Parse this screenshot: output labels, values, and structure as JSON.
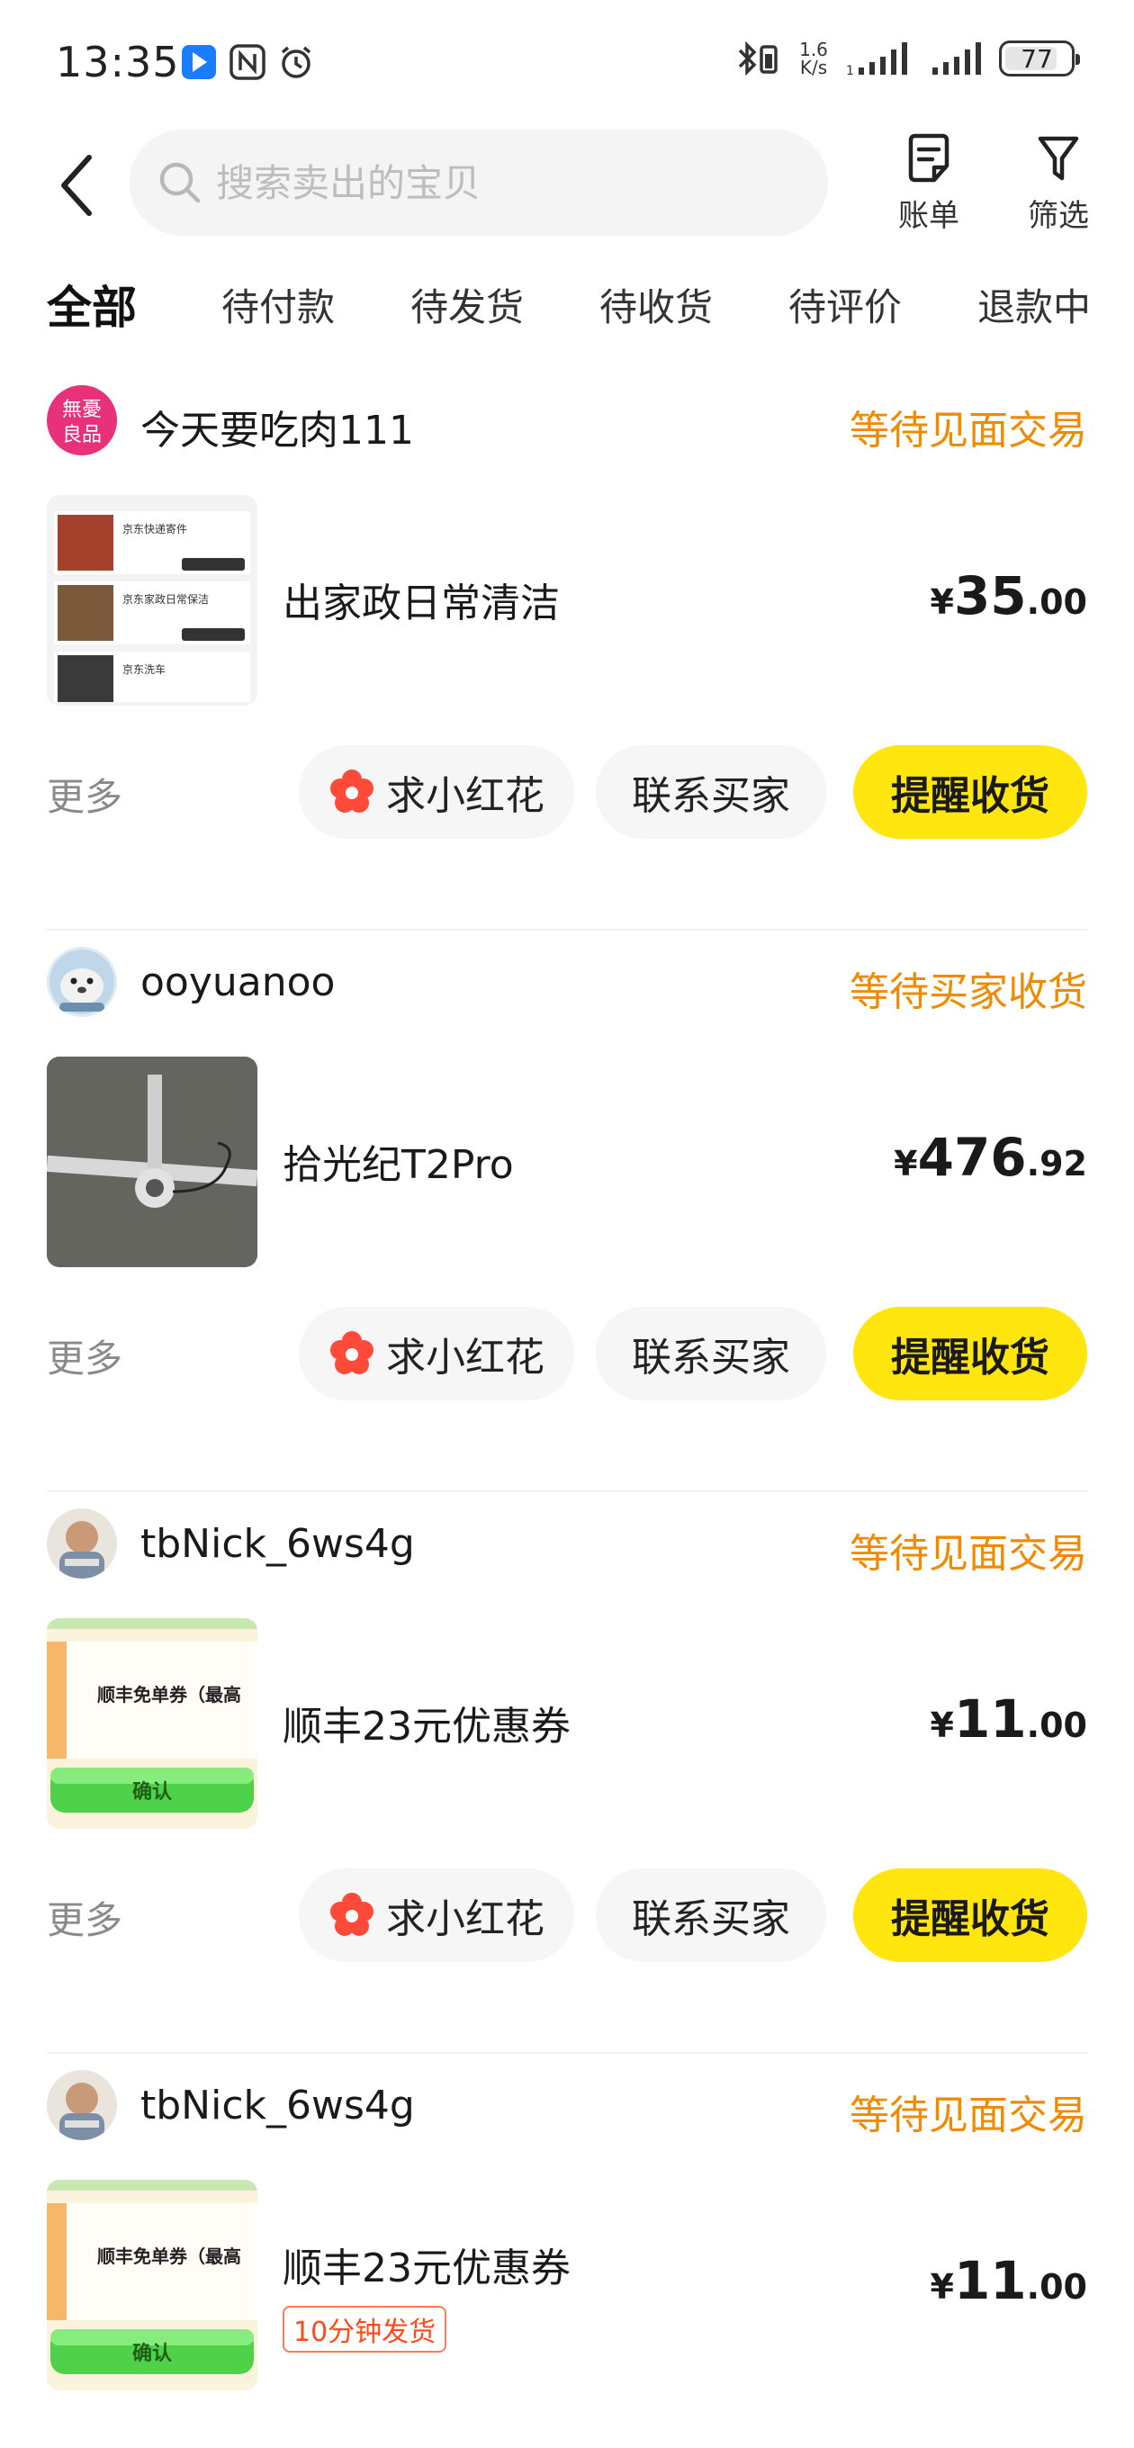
{
  "status_bar": {
    "time": "13:35",
    "net_speed_value": "1.6",
    "net_speed_unit": "K/s",
    "battery": "77"
  },
  "header": {
    "search_placeholder": "搜索卖出的宝贝",
    "bill_label": "账单",
    "filter_label": "筛选"
  },
  "tabs": [
    {
      "label": "全部",
      "active": true
    },
    {
      "label": "待付款",
      "active": false
    },
    {
      "label": "待发货",
      "active": false
    },
    {
      "label": "待收货",
      "active": false
    },
    {
      "label": "待评价",
      "active": false
    },
    {
      "label": "退款中",
      "active": false
    }
  ],
  "orders": [
    {
      "buyer": "今天要吃肉111",
      "status": "等待见面交易",
      "title": "出家政日常清洁",
      "price_currency": "¥",
      "price_int": "35",
      "price_dec": ".00",
      "more": "更多",
      "flower_btn": "求小红花",
      "contact_btn": "联系买家",
      "remind_btn": "提醒收货",
      "avatar_text": "無憂良品",
      "thumb_lines": [
        "京东快递寄件",
        "京东家政日常保洁",
        "京东洗车"
      ]
    },
    {
      "buyer": "ooyuanoo",
      "status": "等待买家收货",
      "title": "拾光纪T2Pro",
      "price_currency": "¥",
      "price_int": "476",
      "price_dec": ".92",
      "more": "更多",
      "flower_btn": "求小红花",
      "contact_btn": "联系买家",
      "remind_btn": "提醒收货"
    },
    {
      "buyer": "tbNick_6ws4g",
      "status": "等待见面交易",
      "title": "顺丰23元优惠券",
      "price_currency": "¥",
      "price_int": "11",
      "price_dec": ".00",
      "more": "更多",
      "flower_btn": "求小红花",
      "contact_btn": "联系买家",
      "remind_btn": "提醒收货",
      "thumb_text": "顺丰免单券（最高",
      "thumb_btn": "确认"
    },
    {
      "buyer": "tbNick_6ws4g",
      "status": "等待见面交易",
      "title": "顺丰23元优惠券",
      "tag": "10分钟发货",
      "price_currency": "¥",
      "price_int": "11",
      "price_dec": ".00",
      "thumb_text": "顺丰免单券（最高",
      "thumb_btn": "确认"
    }
  ],
  "colors": {
    "accent_yellow": "#ffe60f",
    "status_orange": "#f08a00",
    "tag_red": "#ff4a1a"
  }
}
